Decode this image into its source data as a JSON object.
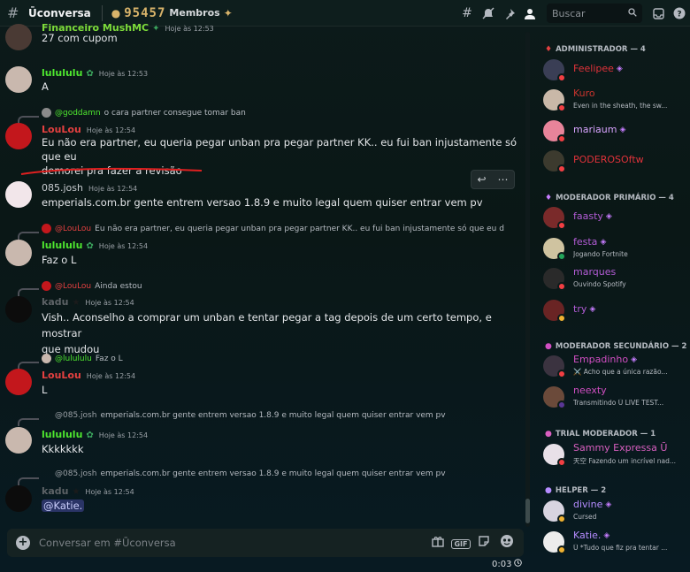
{
  "header": {
    "channel": "Ūconversa",
    "member_count": "95457",
    "member_label": "Membros",
    "search_placeholder": "Buscar"
  },
  "messages": [
    {
      "author": "Financeiro MushMC ",
      "time": "Hoje às 12:53",
      "text": "27 com cupom",
      "color": "#7ddc3a"
    },
    {
      "author": "lulululu",
      "time": "Hoje às 12:53",
      "text": "A",
      "color": "#4ee62f"
    },
    {
      "reply_author": "@goddamn",
      "reply_text": "o cara partner consegue tomar ban",
      "author": "LouLou",
      "time": "Hoje às 12:54",
      "text_line1": "Eu não era partner, eu queria pegar unban pra pegar partner KK.. eu fui ban injustamente só que eu",
      "text_line2": "demorei pra fazer a revisão",
      "color": "#e34040"
    },
    {
      "author": "085.josh",
      "time": "Hoje às 12:54",
      "text": "emperials.com.br gente entrem versao 1.8.9 e muito legal quem quiser entrar vem pv",
      "color": "#c8ccd0"
    },
    {
      "reply_author": "@LouLou",
      "reply_text": "Eu não era partner, eu queria pegar unban pra pegar partner KK.. eu fui ban injustamente só que eu d",
      "author": "lulululu",
      "time": "Hoje às 12:54",
      "text": "Faz o L",
      "color": "#4ee62f"
    },
    {
      "reply_author": "@LouLou",
      "reply_text": "Ainda estou",
      "author": "kadu",
      "time": "Hoje às 12:54",
      "text_line1": "Vish.. Aconselho a comprar um unban e tentar pegar a tag depois de um certo tempo, e mostrar",
      "text_line2": "que mudou",
      "color": "#5d6266"
    },
    {
      "reply_author": "@lulululu",
      "reply_text": "Faz o L",
      "author": "LouLou",
      "time": "Hoje às 12:54",
      "text": "L",
      "color": "#e34040"
    },
    {
      "reply_author": "@085.josh",
      "reply_text": "emperials.com.br gente entrem versao 1.8.9 e muito legal quem quiser entrar vem pv",
      "author": "lulululu",
      "time": "Hoje às 12:54",
      "text": "Kkkkkkk",
      "color": "#4ee62f"
    },
    {
      "reply_author": "@085.josh",
      "reply_text": "emperials.com.br gente entrem versao 1.8.9 e muito legal quem quiser entrar vem pv",
      "author": "kadu",
      "time": "Hoje às 12:54",
      "text": "@Katie.",
      "color": "#5d6266"
    }
  ],
  "composer": {
    "placeholder": "Conversar em #Ūconversa",
    "timer": "0:03"
  },
  "roles": [
    {
      "label": "ADMINISTRADOR — 4"
    },
    {
      "label": "MODERADOR PRIMÁRIO — 4"
    },
    {
      "label": "MODERADOR SECUNDÁRIO — 2"
    },
    {
      "label": "TRIAL MODERADOR — 1"
    },
    {
      "label": "HELPER — 2"
    }
  ],
  "members": [
    {
      "name": "Feelipee",
      "status": "",
      "color": "#e0323a",
      "avatar": "#3a3e55",
      "presence": "#f23f43"
    },
    {
      "name": "Kuro",
      "status": "Even in the sheath, the sw...",
      "color": "#c7342d",
      "avatar": "#c9b8a8",
      "presence": "#f23f43"
    },
    {
      "name": "mariaum",
      "status": "",
      "color": "#d9a3ff",
      "avatar": "#e8849a",
      "presence": "#f23f43"
    },
    {
      "name": "PODEROSOftw",
      "status": "",
      "color": "#e0323a",
      "avatar": "#3c3a2e",
      "presence": "#f23f43"
    },
    {
      "name": "faasty",
      "status": "",
      "color": "#b35cd6",
      "avatar": "#7a2a2a",
      "presence": "#f23f43"
    },
    {
      "name": "festa",
      "status": "Jogando Fortnite",
      "color": "#b35cd6",
      "avatar": "#cfc3a0",
      "presence": "#23a55a"
    },
    {
      "name": "marques",
      "status": "Ouvindo Spotify",
      "color": "#b35cd6",
      "avatar": "#2a2a2a",
      "presence": "#f23f43"
    },
    {
      "name": "try",
      "status": "",
      "color": "#b35cd6",
      "avatar": "#6a2424",
      "presence": "#f0b232"
    },
    {
      "name": "Empadinho",
      "status": "⚔️ Acho que a única razão...",
      "color": "#d04ec2",
      "avatar": "#3b3340",
      "presence": "#f23f43"
    },
    {
      "name": "neexty",
      "status": "Transmitindo Ū LIVE TEST...",
      "color": "#d04ec2",
      "avatar": "#6b4a3a",
      "presence": "#593695"
    },
    {
      "name": "Sammy Expressa Ū",
      "status": "天空 Fazendo um incrível nad...",
      "color": "#d95fc0",
      "avatar": "#e8e0e8",
      "presence": "#f23f43"
    },
    {
      "name": "divine",
      "status": "Cursed",
      "color": "#b58cff",
      "avatar": "#d8d4e0",
      "presence": "#f0b232"
    },
    {
      "name": "Katie.",
      "status": "Ū *Tudo que fiz pra tentar ...",
      "color": "#b58cff",
      "avatar": "#ececec",
      "presence": "#f0b232"
    }
  ]
}
